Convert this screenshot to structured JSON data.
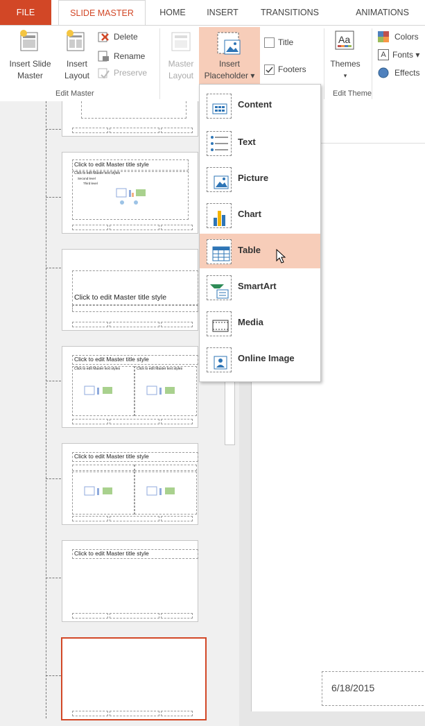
{
  "tabs": [
    "FILE",
    "SLIDE MASTER",
    "HOME",
    "INSERT",
    "TRANSITIONS",
    "ANIMATIONS"
  ],
  "ribbon": {
    "insert_slide_master": [
      "Insert Slide",
      "Master"
    ],
    "insert_layout": [
      "Insert",
      "Layout"
    ],
    "delete": "Delete",
    "rename": "Rename",
    "preserve": "Preserve",
    "edit_master_group": "Edit Master",
    "master_layout": [
      "Master",
      "Layout"
    ],
    "insert_placeholder": [
      "Insert",
      "Placeholder ▾"
    ],
    "title_check": "Title",
    "footers_check": "Footers",
    "themes": "Themes",
    "edit_theme_group": "Edit Theme",
    "colors": "Colors",
    "fonts": "Fonts ▾",
    "effects": "Effects"
  },
  "menu": {
    "items": [
      "Content",
      "Text",
      "Picture",
      "Chart",
      "Table",
      "SmartArt",
      "Media",
      "Online Image"
    ],
    "active_index": 4
  },
  "thumbs": {
    "title_style": "Click to edit Master title style",
    "text_style": "Click to edit Master text styles",
    "second": "Second level",
    "third": "Third level",
    "fourth": "Fourth level",
    "fifth": "Fifth level"
  },
  "canvas": {
    "date": "6/18/2015"
  },
  "colors": {
    "accent": "#d24726",
    "menu_highlight": "#f7cdb9",
    "selection_border": "#d24726"
  }
}
